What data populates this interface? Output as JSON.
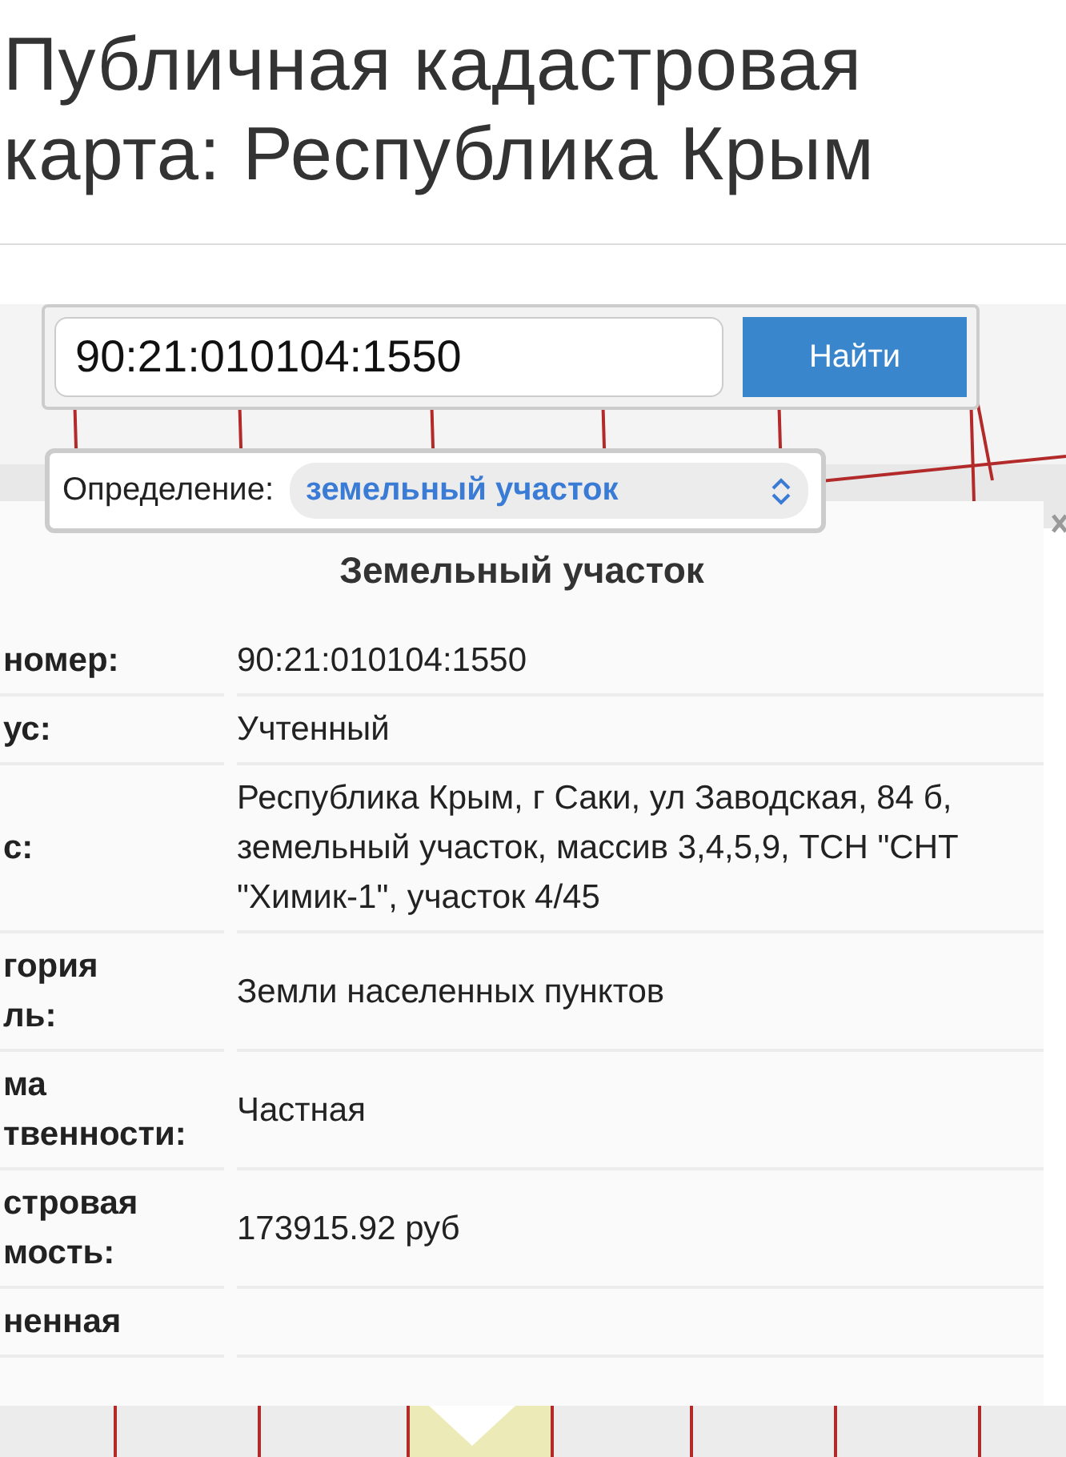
{
  "page": {
    "title": "Публичная кадастровая карта: Республика Крым"
  },
  "search": {
    "value": "90:21:010104:1550",
    "button": "Найти"
  },
  "definition": {
    "label": "Определение:",
    "value": "земельный участок"
  },
  "panel": {
    "heading": "Земельный участок",
    "rows": [
      {
        "label": [
          "номер:"
        ],
        "value": "90:21:010104:1550"
      },
      {
        "label": [
          "ус:"
        ],
        "value": "Учтенный"
      },
      {
        "label": [
          "с:"
        ],
        "value": "Республика Крым, г Саки, ул Заводская, 84 б, земельный участок, массив 3,4,5,9, ТСН \"СНТ \"Химик-1\", участок 4/45"
      },
      {
        "label": [
          "гория",
          "ль:"
        ],
        "value": "Земли населенных пунктов"
      },
      {
        "label": [
          "ма",
          "твенности:"
        ],
        "value": "Частная"
      },
      {
        "label": [
          "стровая",
          "мость:"
        ],
        "value": "173915.92 руб"
      },
      {
        "label": [
          "ненная"
        ]
      }
    ]
  }
}
